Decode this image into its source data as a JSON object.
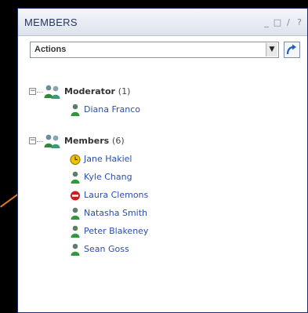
{
  "panel": {
    "title": "MEMBERS",
    "window_controls": [
      "_",
      "□",
      "/",
      "?"
    ]
  },
  "actions": {
    "selected": "Actions",
    "go_icon": "go-arrow-icon"
  },
  "groups": [
    {
      "label": "Moderator",
      "count": "(1)",
      "icon": "group-icon",
      "members": [
        {
          "name": "Diana Franco",
          "status": "online",
          "icon": "user-online-icon"
        }
      ]
    },
    {
      "label": "Members",
      "count": "(6)",
      "icon": "group-icon",
      "members": [
        {
          "name": "Jane Hakiel",
          "status": "away",
          "icon": "user-away-icon"
        },
        {
          "name": "Kyle Chang",
          "status": "online",
          "icon": "user-online-icon"
        },
        {
          "name": "Laura Clemons",
          "status": "do-not-disturb",
          "icon": "do-not-disturb-icon"
        },
        {
          "name": "Natasha Smith",
          "status": "online",
          "icon": "user-online-icon"
        },
        {
          "name": "Peter Blakeney",
          "status": "online",
          "icon": "user-online-icon"
        },
        {
          "name": "Sean Goss",
          "status": "online",
          "icon": "user-online-icon"
        }
      ]
    }
  ],
  "colors": {
    "online": "#2f9a3a",
    "away": "#d9a400",
    "dnd": "#cc1c1c",
    "link": "#2b4fa8",
    "title": "#27375c",
    "accent_line": "#e07a2a"
  }
}
